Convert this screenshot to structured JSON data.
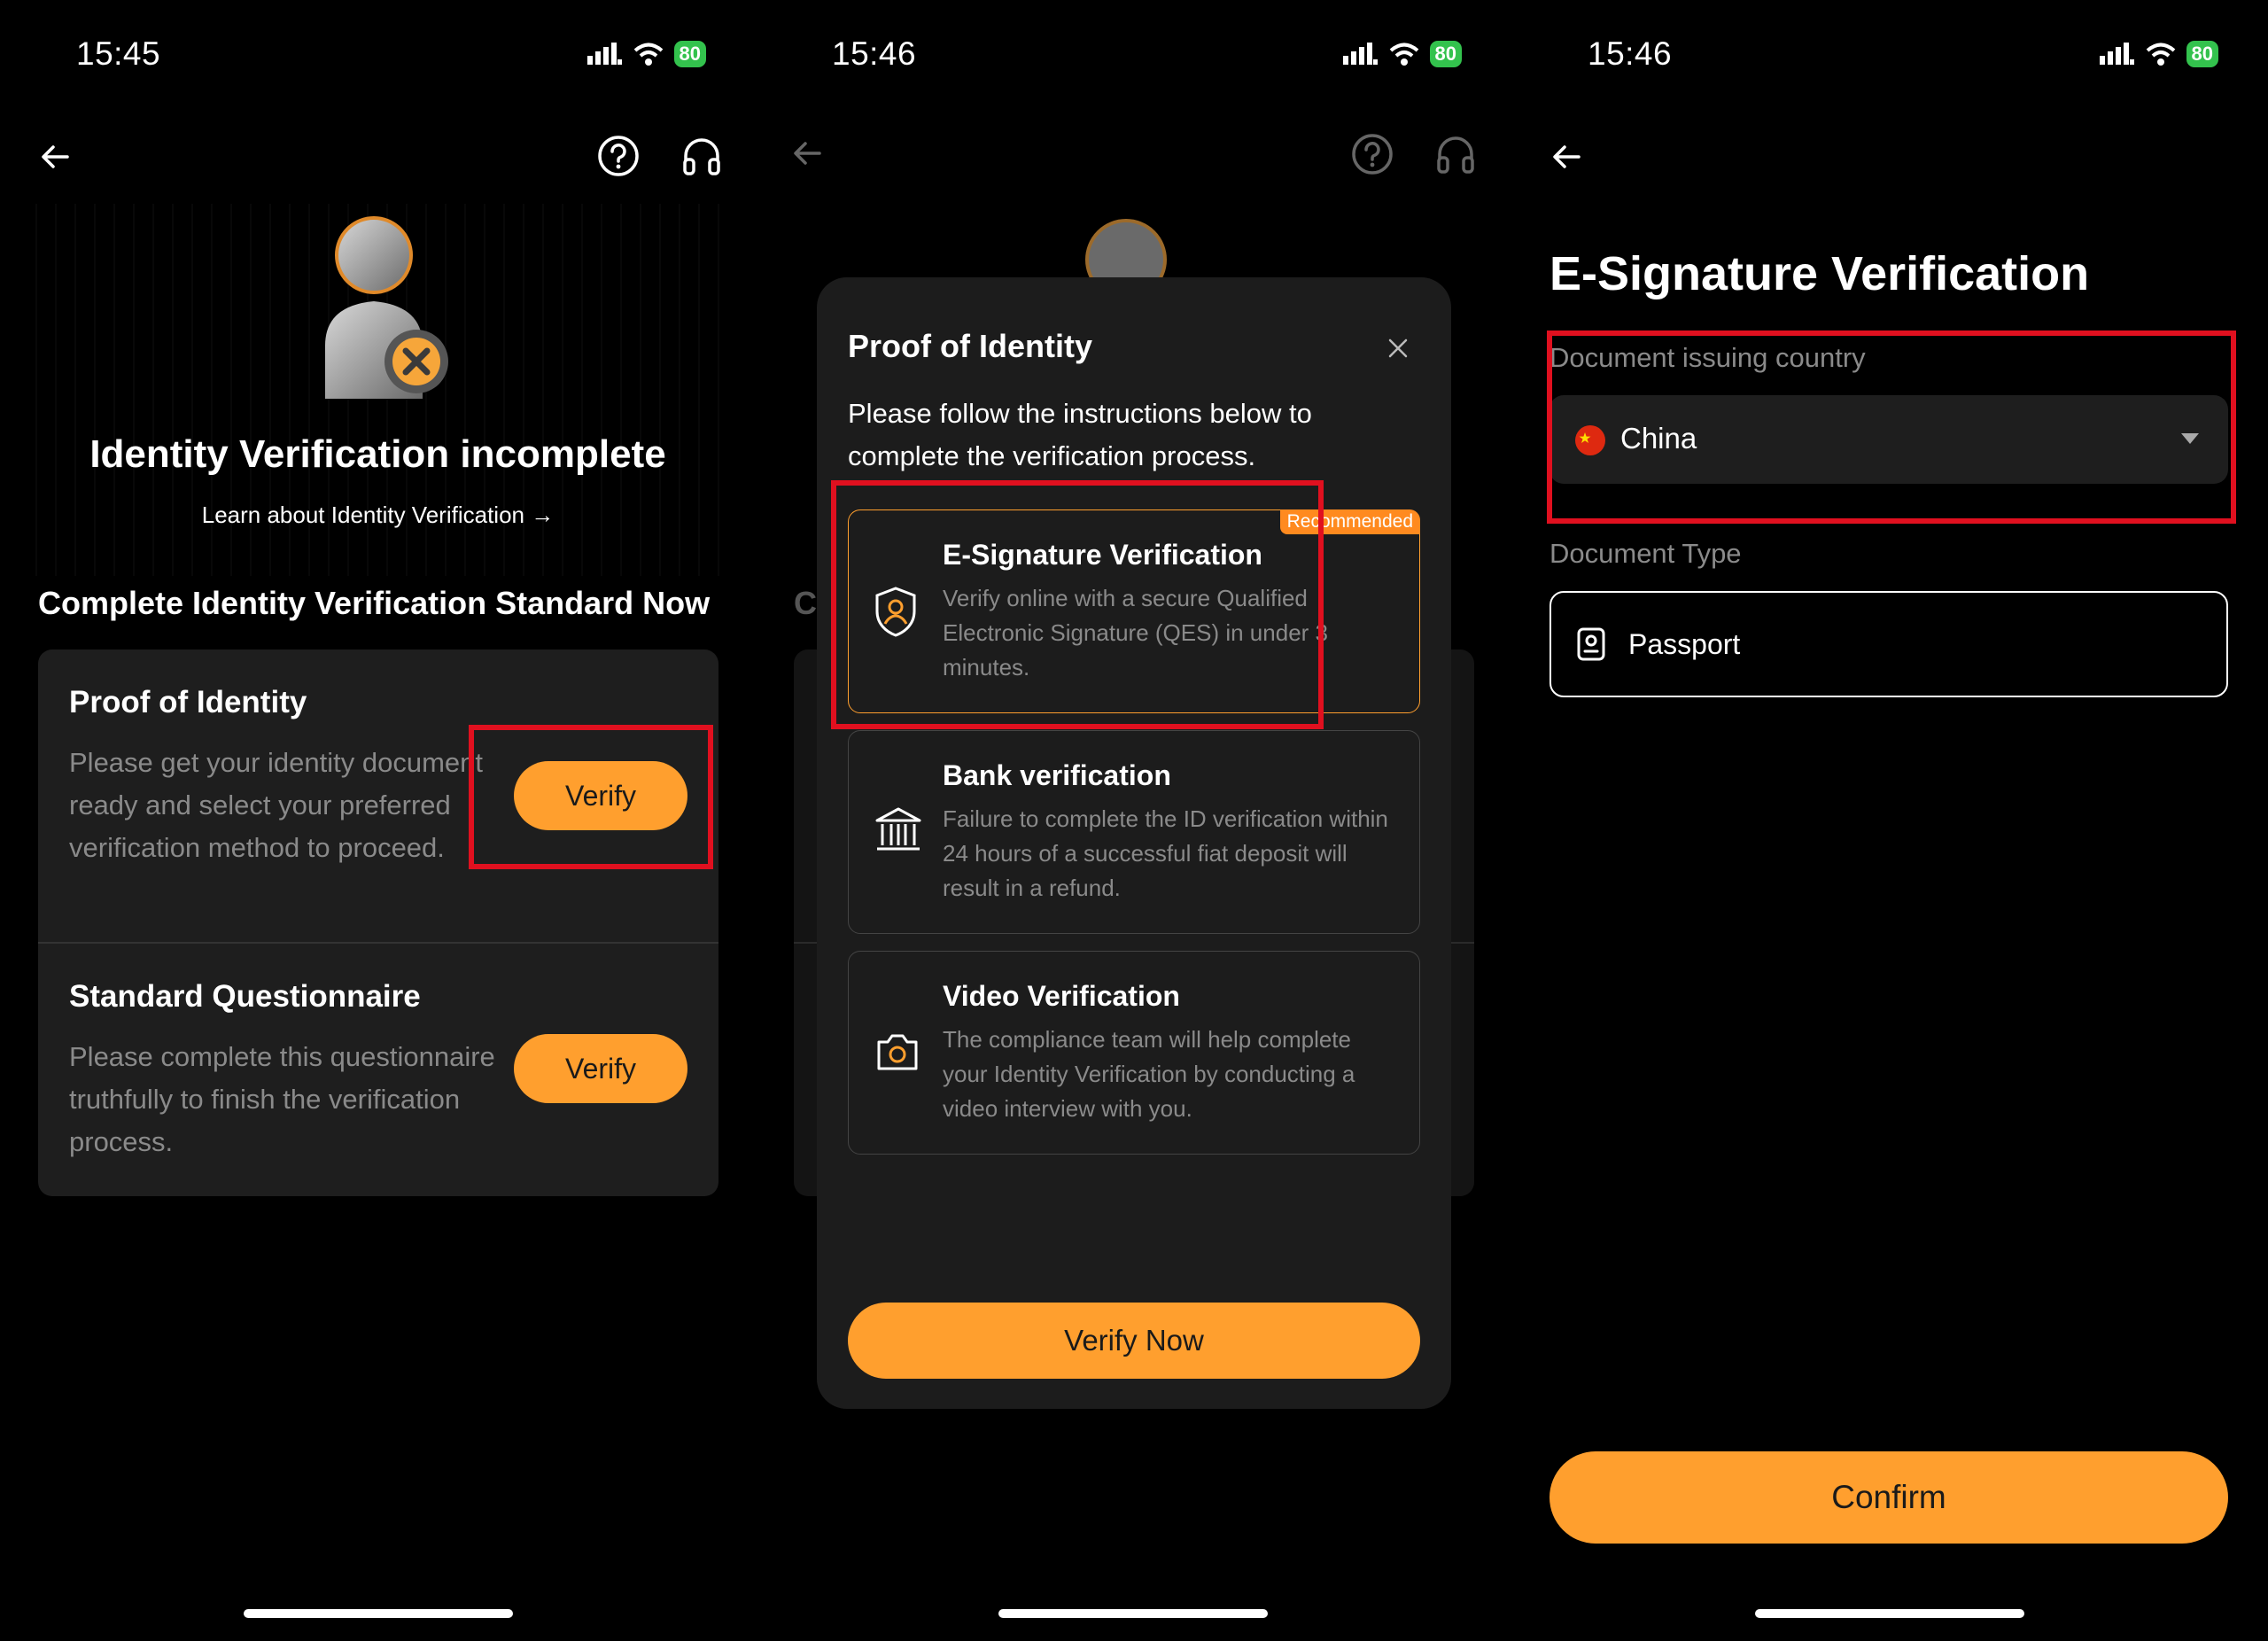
{
  "screen1": {
    "time": "15:45",
    "battery": "80",
    "title": "Identity Verification incomplete",
    "learn_link": "Learn about Identity Verification",
    "section_heading": "Complete Identity Verification Standard Now",
    "cards": [
      {
        "title": "Proof of Identity",
        "desc": "Please get your identity document ready and select your preferred verification method to proceed.",
        "button": "Verify"
      },
      {
        "title": "Standard Questionnaire",
        "desc": "Please complete this questionnaire truthfully to finish the verification process.",
        "button": "Verify"
      }
    ]
  },
  "screen2": {
    "time": "15:46",
    "battery": "80",
    "modal": {
      "title": "Proof of Identity",
      "instructions": "Please follow the instructions below to complete the verification process.",
      "options": [
        {
          "title": "E-Signature Verification",
          "desc": "Verify online with a secure Qualified Electronic Signature (QES) in under 3 minutes.",
          "badge": "Recommended",
          "icon": "shield-user-icon"
        },
        {
          "title": "Bank verification",
          "desc": "Failure to complete the ID verification within 24 hours of a successful fiat deposit will result in a refund.",
          "icon": "bank-icon"
        },
        {
          "title": "Video Verification",
          "desc": "The compliance team will help complete your Identity Verification by conducting a video interview with you.",
          "icon": "camera-icon"
        }
      ],
      "button": "Verify Now"
    },
    "peek_letter": "C"
  },
  "screen3": {
    "time": "15:46",
    "battery": "80",
    "title": "E-Signature Verification",
    "country_label": "Document issuing country",
    "country_value": "China",
    "doc_type_label": "Document Type",
    "doc_type_value": "Passport",
    "confirm": "Confirm"
  },
  "colors": {
    "accent": "#ff9f2e",
    "highlight": "#e0101f",
    "card": "#1e1e1e",
    "muted": "#8a8a8a"
  }
}
